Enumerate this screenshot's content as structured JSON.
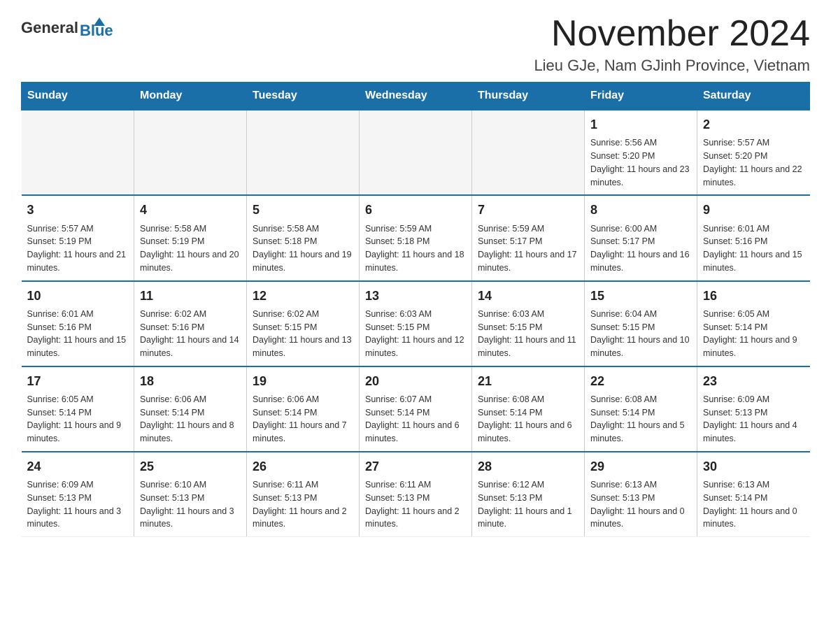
{
  "header": {
    "logo_general": "General",
    "logo_blue": "Blue",
    "title": "November 2024",
    "subtitle": "Lieu GJe, Nam GJinh Province, Vietnam"
  },
  "calendar": {
    "days_of_week": [
      "Sunday",
      "Monday",
      "Tuesday",
      "Wednesday",
      "Thursday",
      "Friday",
      "Saturday"
    ],
    "weeks": [
      [
        {
          "day": "",
          "info": ""
        },
        {
          "day": "",
          "info": ""
        },
        {
          "day": "",
          "info": ""
        },
        {
          "day": "",
          "info": ""
        },
        {
          "day": "",
          "info": ""
        },
        {
          "day": "1",
          "info": "Sunrise: 5:56 AM\nSunset: 5:20 PM\nDaylight: 11 hours and 23 minutes."
        },
        {
          "day": "2",
          "info": "Sunrise: 5:57 AM\nSunset: 5:20 PM\nDaylight: 11 hours and 22 minutes."
        }
      ],
      [
        {
          "day": "3",
          "info": "Sunrise: 5:57 AM\nSunset: 5:19 PM\nDaylight: 11 hours and 21 minutes."
        },
        {
          "day": "4",
          "info": "Sunrise: 5:58 AM\nSunset: 5:19 PM\nDaylight: 11 hours and 20 minutes."
        },
        {
          "day": "5",
          "info": "Sunrise: 5:58 AM\nSunset: 5:18 PM\nDaylight: 11 hours and 19 minutes."
        },
        {
          "day": "6",
          "info": "Sunrise: 5:59 AM\nSunset: 5:18 PM\nDaylight: 11 hours and 18 minutes."
        },
        {
          "day": "7",
          "info": "Sunrise: 5:59 AM\nSunset: 5:17 PM\nDaylight: 11 hours and 17 minutes."
        },
        {
          "day": "8",
          "info": "Sunrise: 6:00 AM\nSunset: 5:17 PM\nDaylight: 11 hours and 16 minutes."
        },
        {
          "day": "9",
          "info": "Sunrise: 6:01 AM\nSunset: 5:16 PM\nDaylight: 11 hours and 15 minutes."
        }
      ],
      [
        {
          "day": "10",
          "info": "Sunrise: 6:01 AM\nSunset: 5:16 PM\nDaylight: 11 hours and 15 minutes."
        },
        {
          "day": "11",
          "info": "Sunrise: 6:02 AM\nSunset: 5:16 PM\nDaylight: 11 hours and 14 minutes."
        },
        {
          "day": "12",
          "info": "Sunrise: 6:02 AM\nSunset: 5:15 PM\nDaylight: 11 hours and 13 minutes."
        },
        {
          "day": "13",
          "info": "Sunrise: 6:03 AM\nSunset: 5:15 PM\nDaylight: 11 hours and 12 minutes."
        },
        {
          "day": "14",
          "info": "Sunrise: 6:03 AM\nSunset: 5:15 PM\nDaylight: 11 hours and 11 minutes."
        },
        {
          "day": "15",
          "info": "Sunrise: 6:04 AM\nSunset: 5:15 PM\nDaylight: 11 hours and 10 minutes."
        },
        {
          "day": "16",
          "info": "Sunrise: 6:05 AM\nSunset: 5:14 PM\nDaylight: 11 hours and 9 minutes."
        }
      ],
      [
        {
          "day": "17",
          "info": "Sunrise: 6:05 AM\nSunset: 5:14 PM\nDaylight: 11 hours and 9 minutes."
        },
        {
          "day": "18",
          "info": "Sunrise: 6:06 AM\nSunset: 5:14 PM\nDaylight: 11 hours and 8 minutes."
        },
        {
          "day": "19",
          "info": "Sunrise: 6:06 AM\nSunset: 5:14 PM\nDaylight: 11 hours and 7 minutes."
        },
        {
          "day": "20",
          "info": "Sunrise: 6:07 AM\nSunset: 5:14 PM\nDaylight: 11 hours and 6 minutes."
        },
        {
          "day": "21",
          "info": "Sunrise: 6:08 AM\nSunset: 5:14 PM\nDaylight: 11 hours and 6 minutes."
        },
        {
          "day": "22",
          "info": "Sunrise: 6:08 AM\nSunset: 5:14 PM\nDaylight: 11 hours and 5 minutes."
        },
        {
          "day": "23",
          "info": "Sunrise: 6:09 AM\nSunset: 5:13 PM\nDaylight: 11 hours and 4 minutes."
        }
      ],
      [
        {
          "day": "24",
          "info": "Sunrise: 6:09 AM\nSunset: 5:13 PM\nDaylight: 11 hours and 3 minutes."
        },
        {
          "day": "25",
          "info": "Sunrise: 6:10 AM\nSunset: 5:13 PM\nDaylight: 11 hours and 3 minutes."
        },
        {
          "day": "26",
          "info": "Sunrise: 6:11 AM\nSunset: 5:13 PM\nDaylight: 11 hours and 2 minutes."
        },
        {
          "day": "27",
          "info": "Sunrise: 6:11 AM\nSunset: 5:13 PM\nDaylight: 11 hours and 2 minutes."
        },
        {
          "day": "28",
          "info": "Sunrise: 6:12 AM\nSunset: 5:13 PM\nDaylight: 11 hours and 1 minute."
        },
        {
          "day": "29",
          "info": "Sunrise: 6:13 AM\nSunset: 5:13 PM\nDaylight: 11 hours and 0 minutes."
        },
        {
          "day": "30",
          "info": "Sunrise: 6:13 AM\nSunset: 5:14 PM\nDaylight: 11 hours and 0 minutes."
        }
      ]
    ]
  }
}
